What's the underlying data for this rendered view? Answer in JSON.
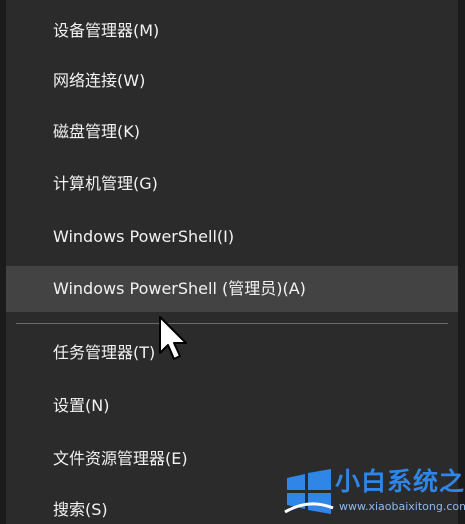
{
  "menu": {
    "items": [
      {
        "label": "设备管理器(M)"
      },
      {
        "label": "网络连接(W)"
      },
      {
        "label": "磁盘管理(K)"
      },
      {
        "label": "计算机管理(G)"
      },
      {
        "label": "Windows PowerShell(I)"
      },
      {
        "label": "Windows PowerShell (管理员)(A)",
        "highlighted": true
      },
      {
        "label": "任务管理器(T)"
      },
      {
        "label": "设置(N)"
      },
      {
        "label": "文件资源管理器(E)"
      },
      {
        "label": "搜索(S)"
      }
    ]
  },
  "watermark": {
    "title": "小白系统之家",
    "url": "www.xiaobaixitong.com"
  },
  "colors": {
    "menu_background": "#2b2b2b",
    "highlight": "#434343",
    "text": "#f2f2f2",
    "watermark_blue": "#2f86e6"
  },
  "icons": {
    "cursor": "mouse-pointer-icon",
    "watermark_logo": "windows-logo-icon"
  }
}
